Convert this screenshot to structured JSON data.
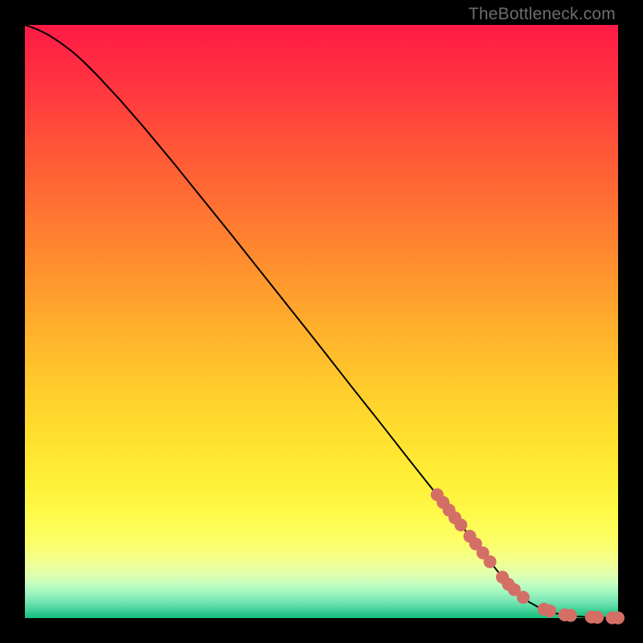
{
  "watermark": "TheBottleneck.com",
  "colors": {
    "frame": "#000000",
    "line": "#000000",
    "marker_fill": "#d46f66",
    "marker_stroke": "#b85a51"
  },
  "chart_data": {
    "type": "line",
    "title": "",
    "xlabel": "",
    "ylabel": "",
    "xlim": [
      0,
      100
    ],
    "ylim": [
      0,
      100
    ],
    "grid": false,
    "legend": false,
    "series": [
      {
        "name": "curve",
        "style": "line",
        "x": [
          0,
          2,
          4,
          6,
          8,
          10,
          12,
          16,
          20,
          25,
          30,
          35,
          40,
          45,
          50,
          55,
          60,
          65,
          70,
          75,
          80,
          83,
          85,
          87,
          89,
          91,
          93,
          95,
          97,
          99,
          100
        ],
        "y": [
          100,
          99.3,
          98.3,
          97.0,
          95.5,
          93.7,
          91.7,
          87.4,
          82.8,
          76.8,
          70.6,
          64.4,
          58.1,
          51.8,
          45.5,
          39.1,
          32.8,
          26.4,
          20.1,
          13.8,
          7.5,
          4.3,
          2.7,
          1.6,
          0.9,
          0.5,
          0.28,
          0.16,
          0.09,
          0.04,
          0.03
        ]
      },
      {
        "name": "markers",
        "style": "points",
        "x": [
          69.5,
          70.5,
          71.5,
          72.5,
          73.5,
          75.0,
          76.0,
          77.2,
          78.4,
          80.5,
          81.5,
          82.5,
          84.0,
          87.5,
          88.5,
          91.0,
          92.0,
          95.5,
          96.5,
          99.0,
          100.0
        ],
        "y": [
          20.8,
          19.5,
          18.2,
          16.9,
          15.7,
          13.8,
          12.5,
          11.0,
          9.5,
          6.9,
          5.7,
          4.8,
          3.5,
          1.5,
          1.2,
          0.55,
          0.45,
          0.17,
          0.13,
          0.05,
          0.03
        ]
      }
    ]
  }
}
